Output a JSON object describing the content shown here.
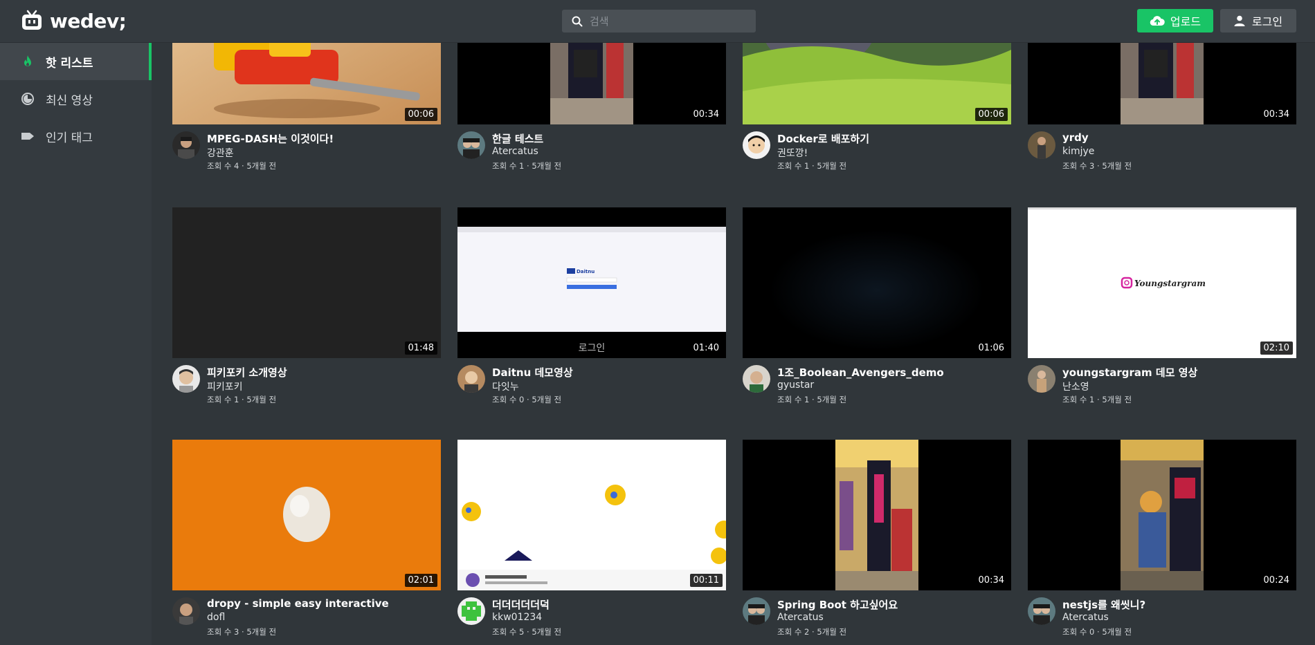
{
  "header": {
    "logo_text": "wedev;",
    "search_placeholder": "검색",
    "upload_label": "업로드",
    "login_label": "로그인"
  },
  "sidebar": {
    "items": [
      {
        "label": "핫 리스트",
        "icon": "flame-icon",
        "active": true
      },
      {
        "label": "최신 영상",
        "icon": "clock-icon",
        "active": false
      },
      {
        "label": "인기 태그",
        "icon": "tag-icon",
        "active": false
      }
    ]
  },
  "colors": {
    "accent": "#19c466",
    "background": "#30363a",
    "header": "#343a3f"
  },
  "videos": [
    {
      "title": "MPEG-DASH는 이것이다!",
      "author": "강관훈",
      "stats": "조회 수 4 · 5개월 전",
      "duration": "00:06"
    },
    {
      "title": "한글 테스트",
      "author": "Atercatus",
      "stats": "조회 수 1 · 5개월 전",
      "duration": "00:34"
    },
    {
      "title": "Docker로 배포하기",
      "author": "권또깡!",
      "stats": "조회 수 1 · 5개월 전",
      "duration": "00:06"
    },
    {
      "title": "yrdy",
      "author": "kimjye",
      "stats": "조회 수 3 · 5개월 전",
      "duration": "00:34"
    },
    {
      "title": "피키포키 소개영상",
      "author": "피키포키",
      "stats": "조회 수 1 · 5개월 전",
      "duration": "01:48"
    },
    {
      "title": "Daitnu 데모영상",
      "author": "다잇누",
      "stats": "조회 수 0 · 5개월 전",
      "duration": "01:40"
    },
    {
      "title": "1조_Boolean_Avengers_demo",
      "author": "gyustar",
      "stats": "조회 수 1 · 5개월 전",
      "duration": "01:06"
    },
    {
      "title": "youngstargram 데모 영상",
      "author": "난소영",
      "stats": "조회 수 1 · 5개월 전",
      "duration": "02:10"
    },
    {
      "title": "dropy - simple easy interactive",
      "author": "dofl",
      "stats": "조회 수 3 · 5개월 전",
      "duration": "02:01"
    },
    {
      "title": "더더더더더덕",
      "author": "kkw01234",
      "stats": "조회 수 5 · 5개월 전",
      "duration": "00:11"
    },
    {
      "title": "Spring Boot 하고싶어요",
      "author": "Atercatus",
      "stats": "조회 수 2 · 5개월 전",
      "duration": "00:34"
    },
    {
      "title": "nestjs를 왜씻니?",
      "author": "Atercatus",
      "stats": "조회 수 0 · 5개월 전",
      "duration": "00:24"
    }
  ],
  "thumbnail_texts": {
    "daitnu_login": "로그인",
    "daitnu_brand": "Daitnu",
    "youngstargram": "Youngstargram"
  }
}
